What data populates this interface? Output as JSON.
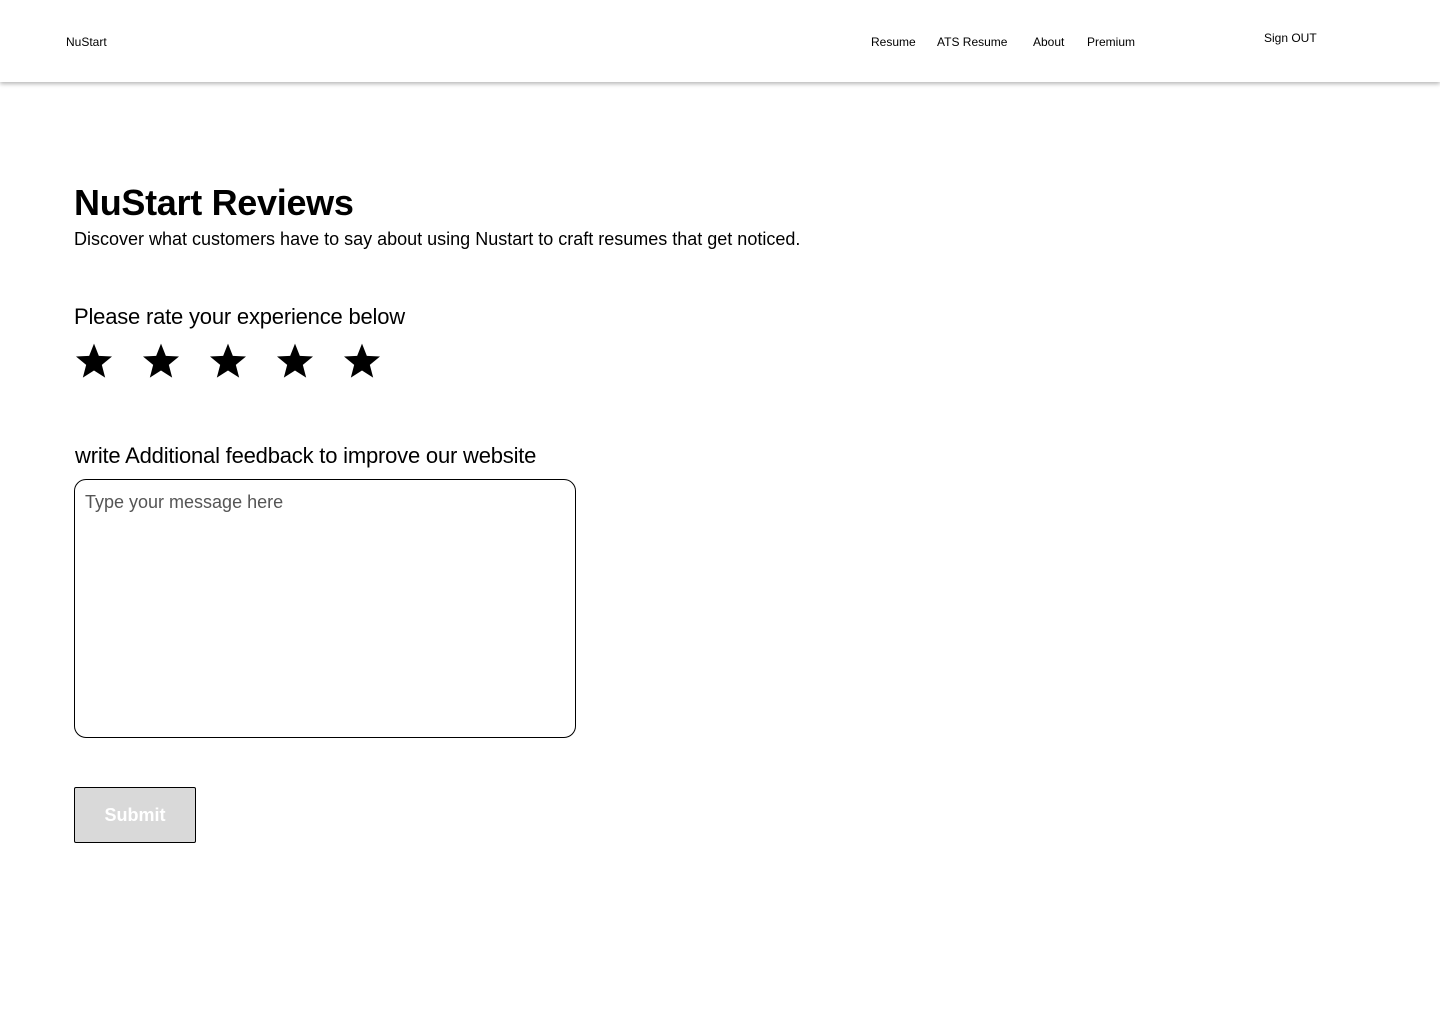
{
  "header": {
    "brand": "NuStart",
    "nav": {
      "resume": "Resume",
      "ats_resume": "ATS Resume",
      "about": "About",
      "premium": "Premium"
    },
    "sign_out": "Sign OUT"
  },
  "main": {
    "title": "NuStart Reviews",
    "subtitle": "Discover what customers have to say about using Nustart to craft resumes that get noticed.",
    "rating": {
      "label": "Please rate your experience below",
      "star_icon": "star-icon",
      "max": 5,
      "star_color": "#000000"
    },
    "feedback": {
      "label": "write Additional feedback to improve our website",
      "value": "",
      "placeholder": "Type your message here"
    },
    "submit_label": "Submit"
  },
  "colors": {
    "submit_background": "#d9d9d9",
    "submit_text": "#ffffff",
    "border": "#000000",
    "placeholder": "#555555"
  }
}
